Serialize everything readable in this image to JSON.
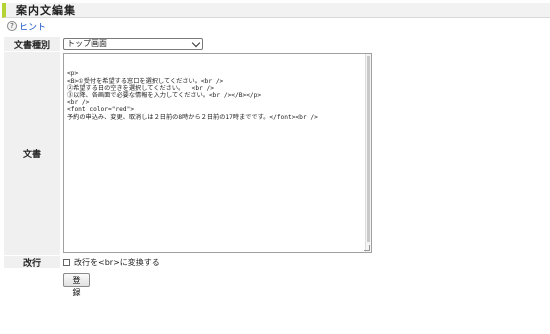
{
  "page": {
    "title": "案内文編集"
  },
  "hint": {
    "icon_char": "?",
    "label": "ヒント"
  },
  "form": {
    "type": {
      "label": "文書種別",
      "selected": "トップ画面"
    },
    "body": {
      "label": "文書",
      "lines": [
        "<p>",
        "<B>①受付を希望する窓口を選択してください。<br />",
        "②希望する日の空きを選択してください。  <br />",
        "③以降、各画面で必要な情報を入力してください。<br /></B></p>",
        "<br />",
        "<font color=\"red\">",
        "予約の申込み、変更、取消しは２日前の8時から２日前の17時までです。</font><br />"
      ]
    },
    "linebreak": {
      "label": "改行",
      "checkbox_label": "改行を<br>に変換する",
      "checked": false
    },
    "submit_label": "登録"
  }
}
